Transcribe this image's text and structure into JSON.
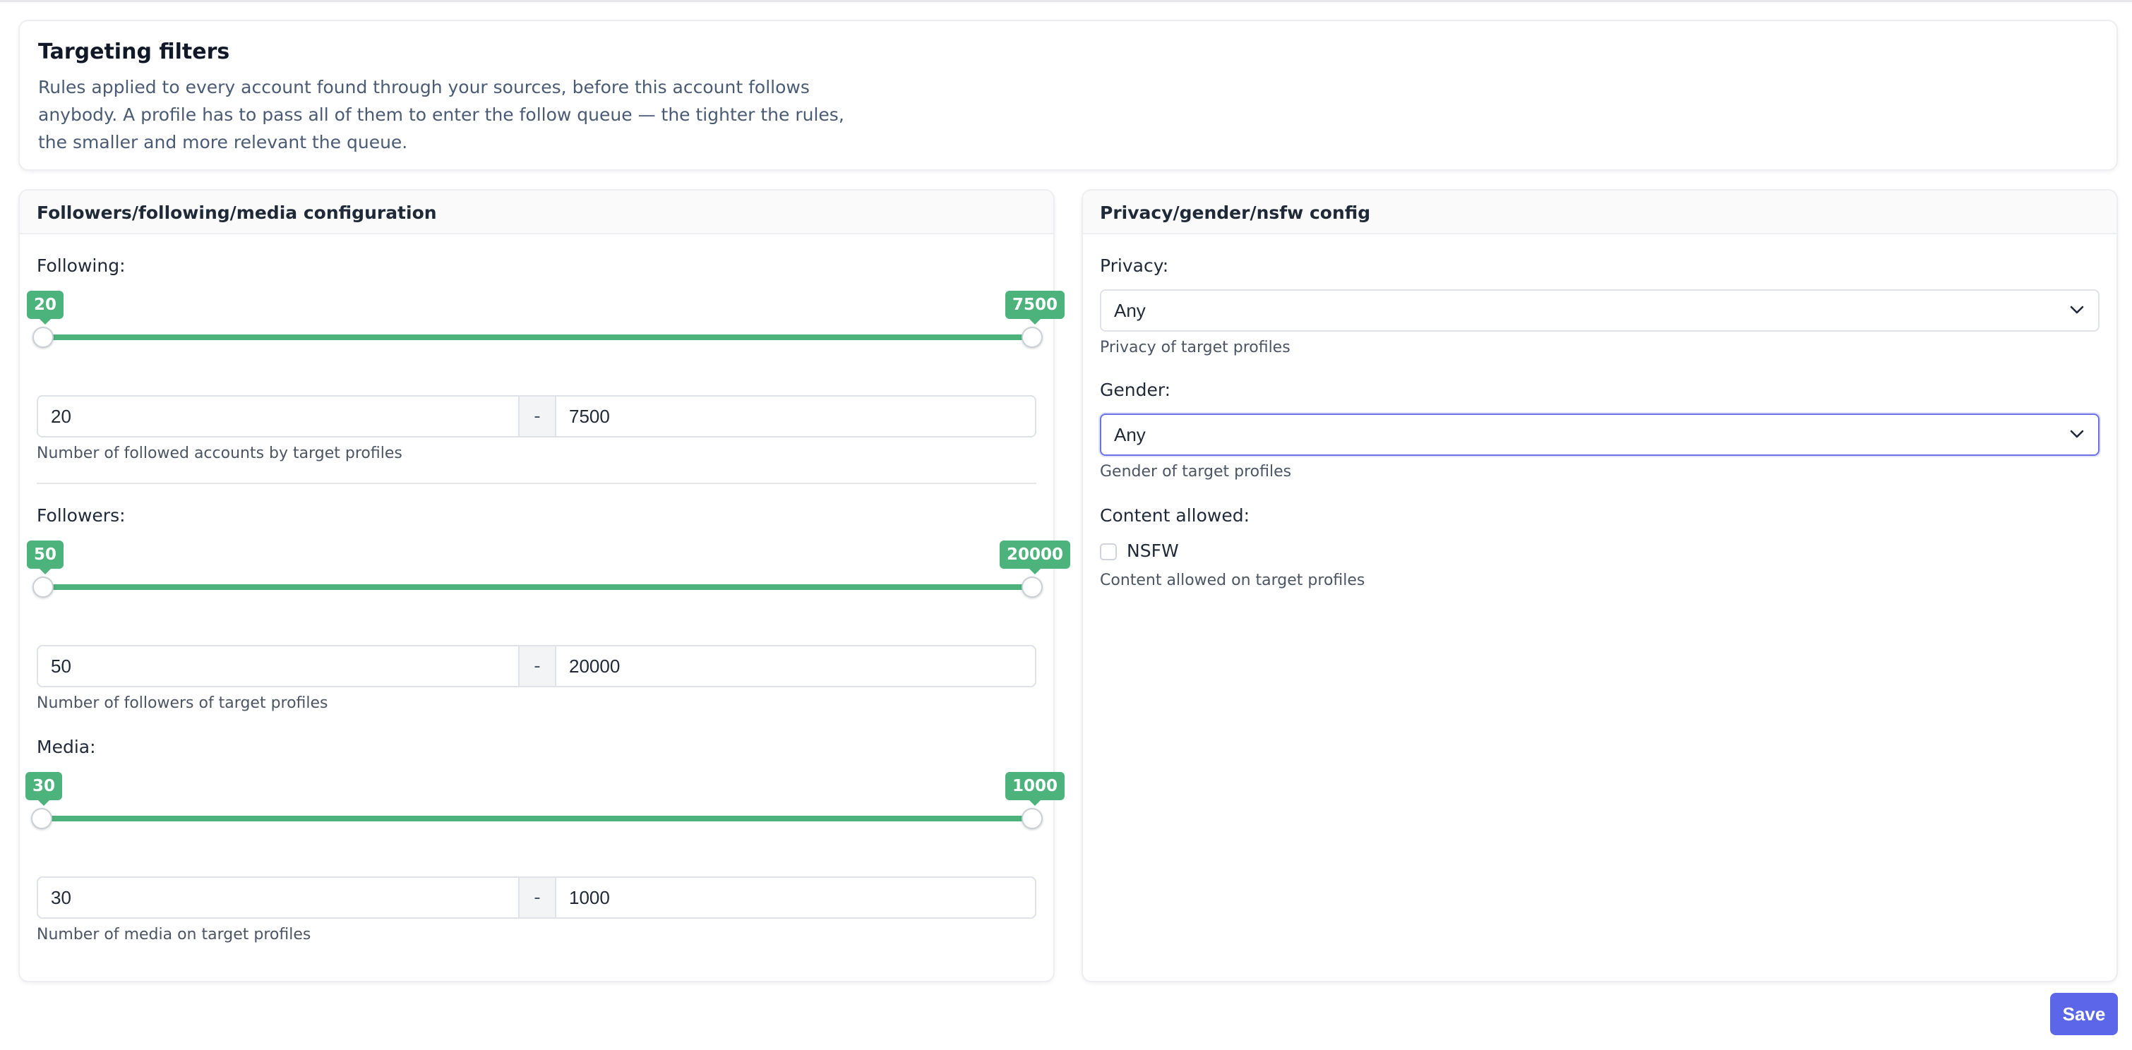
{
  "header": {
    "title": "Targeting filters",
    "description": "Rules applied to every account found through your sources, before this account follows anybody. A profile has to pass all of them to enter the follow queue — the tighter the rules, the smaller and more relevant the queue."
  },
  "left_panel": {
    "title": "Followers/following/media configuration",
    "following": {
      "label": "Following:",
      "min": "20",
      "max": "7500",
      "separator": "-",
      "help": "Number of followed accounts by target profiles"
    },
    "followers": {
      "label": "Followers:",
      "min": "50",
      "max": "20000",
      "separator": "-",
      "help": "Number of followers of target profiles"
    },
    "media": {
      "label": "Media:",
      "min": "30",
      "max": "1000",
      "separator": "-",
      "help": "Number of media on target profiles"
    }
  },
  "right_panel": {
    "title": "Privacy/gender/nsfw config",
    "privacy": {
      "label": "Privacy:",
      "value": "Any",
      "help": "Privacy of target profiles"
    },
    "gender": {
      "label": "Gender:",
      "value": "Any",
      "help": "Gender of target profiles"
    },
    "content": {
      "label": "Content allowed:",
      "option": "NSFW",
      "checked": false,
      "help": "Content allowed on target profiles"
    }
  },
  "save_label": "Save",
  "colors": {
    "slider": "#4bb37b",
    "primary": "#5b66e8",
    "focus": "#6b72e6"
  },
  "icons": {
    "select_chevron": "chevron-down-icon"
  }
}
